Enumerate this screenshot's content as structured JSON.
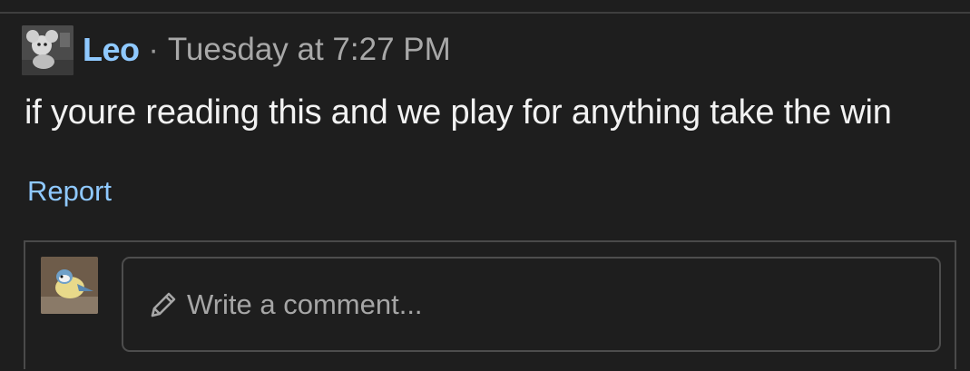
{
  "post": {
    "author": "Leo",
    "separator": "·",
    "timestamp": "Tuesday at 7:27 PM",
    "body": "if youre reading this and we play for anything take the win",
    "report_label": "Report"
  },
  "comment": {
    "placeholder": "Write a comment..."
  },
  "icons": {
    "author_avatar": "avatar-icon",
    "commenter_avatar": "bird-avatar-icon",
    "comment_input": "pencil-icon"
  },
  "colors": {
    "background": "#1e1e1e",
    "link": "#8fc9ff",
    "text": "#f2f2f2",
    "muted": "#a8a8a8",
    "border": "#4a4a4a"
  }
}
